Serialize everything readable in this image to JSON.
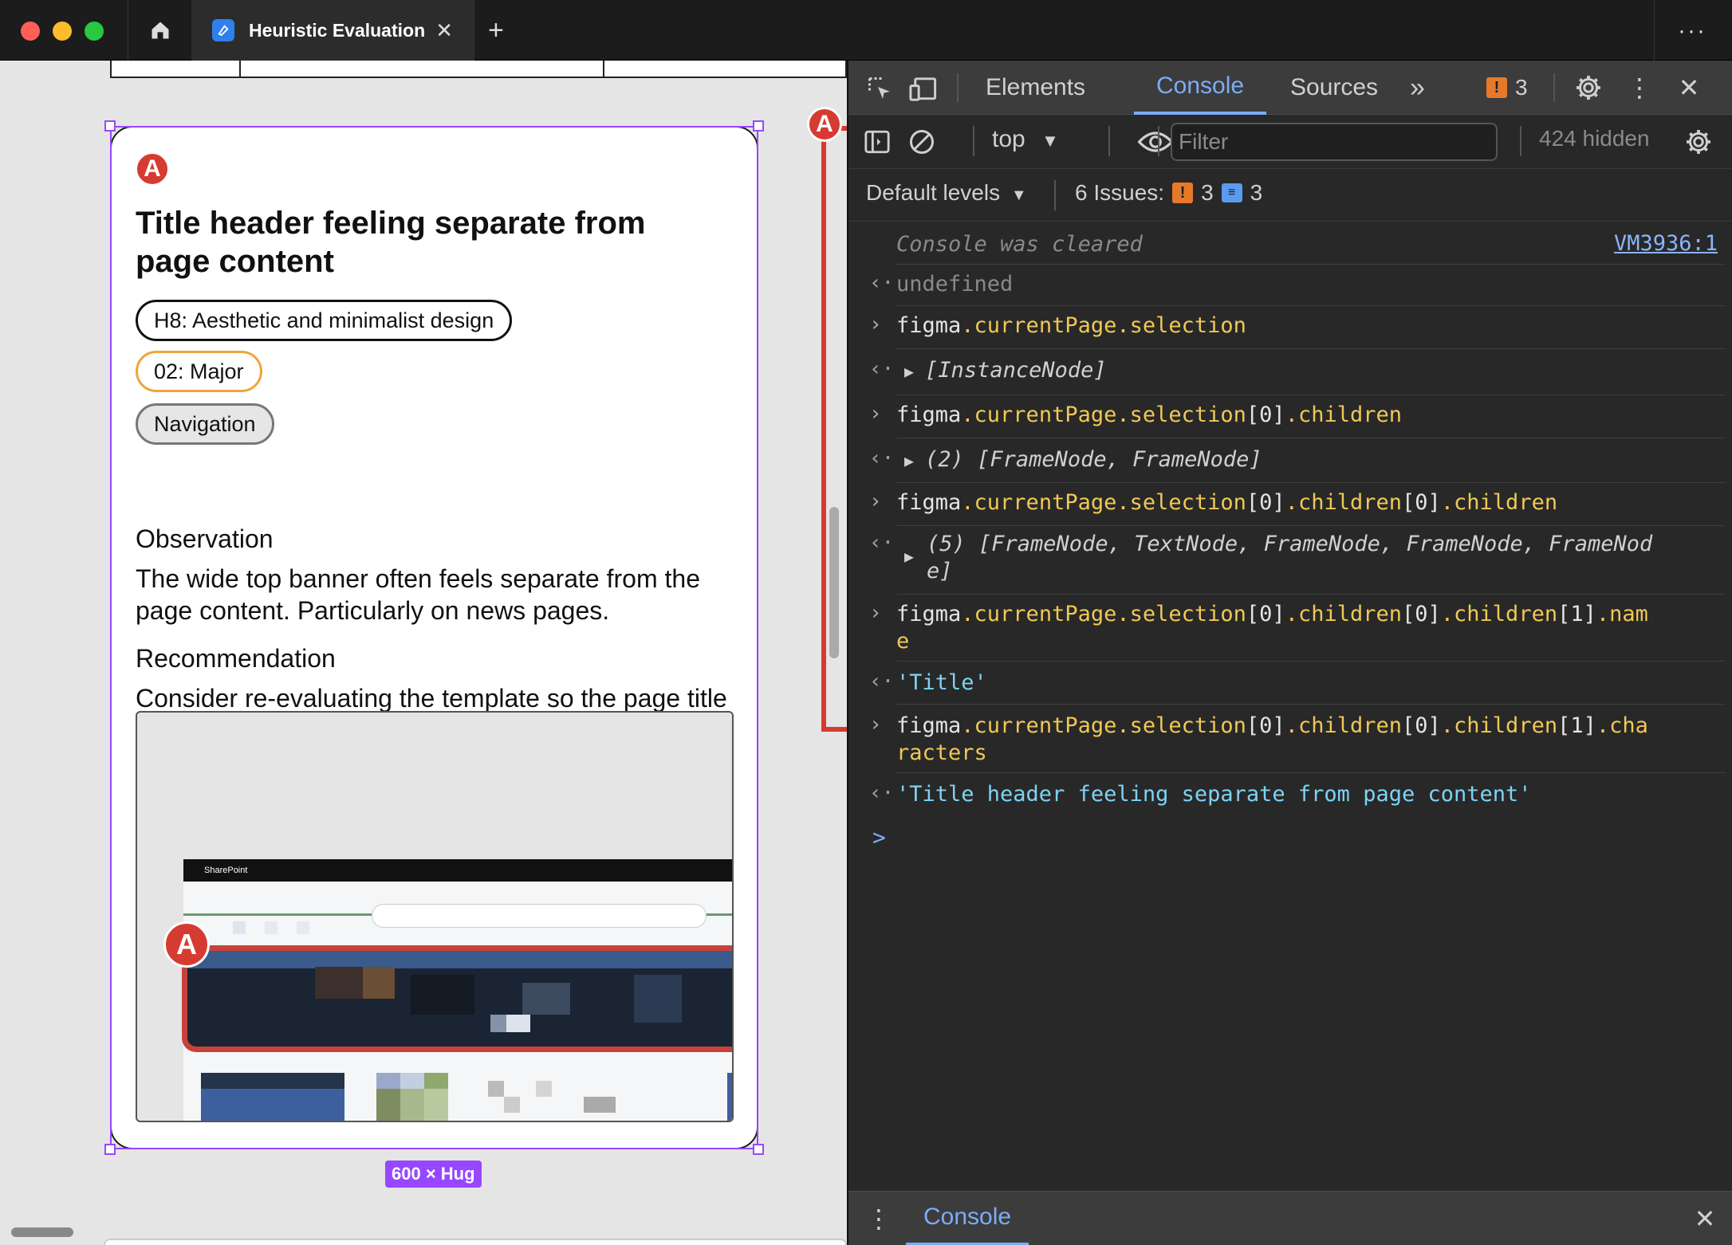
{
  "browser": {
    "tab_title": "Heuristic Evaluation",
    "close_tab_glyph": "✕",
    "new_tab_glyph": "+",
    "more_glyph": "···"
  },
  "canvas": {
    "card": {
      "badge": "A",
      "title": "Title header feeling separate from page content",
      "heuristic_tag": "H8: Aesthetic and minimalist design",
      "severity_tag": "02: Major",
      "category_tag": "Navigation",
      "observation_heading": "Observation",
      "observation_text": "The wide top banner often feels separate from the page content. Particularly on news pages.",
      "recommendation_heading": "Recommendation",
      "recommendation_text": "Consider re-evaluating the template so the page title sits within the body content.",
      "screenshot": {
        "app_name": "SharePoint",
        "badge": "A"
      }
    },
    "size_label": "600 × Hug",
    "marker_badge": "A"
  },
  "devtools": {
    "tabs": [
      {
        "label": "Elements"
      },
      {
        "label": "Console"
      },
      {
        "label": "Sources"
      }
    ],
    "more_tabs": "»",
    "issue_count": "3",
    "context": "top",
    "filter_placeholder": "Filter",
    "hidden_count": "424 hidden",
    "default_levels": "Default levels",
    "issues_label": "6 Issues:",
    "issues_warn": "3",
    "issues_info": "3",
    "console": {
      "cleared": "Console was cleared",
      "cleared_source": "VM3936:1",
      "undefined": "undefined",
      "cmd1_obj": "figma",
      "cmd1_props": ".currentPage.selection",
      "out1": "[InstanceNode]",
      "cmd2_a": "figma",
      "cmd2_b": ".currentPage.selection",
      "cmd2_c": "[0]",
      "cmd2_d": ".children",
      "out2": "(2) [FrameNode, FrameNode]",
      "cmd3_a": "figma",
      "cmd3_b": ".currentPage.selection",
      "cmd3_c": "[0]",
      "cmd3_d": ".children",
      "cmd3_e": "[0]",
      "cmd3_f": ".children",
      "out3_line1": "(5) [FrameNode, TextNode, FrameNode, FrameNode, FrameNod",
      "out3_line2": "e]",
      "cmd4_a": "figma",
      "cmd4_b": ".currentPage.selection",
      "cmd4_c": "[0]",
      "cmd4_d": ".children",
      "cmd4_e": "[0]",
      "cmd4_f": ".children",
      "cmd4_g": "[1]",
      "cmd4_h": ".nam",
      "cmd4_wrap": "e",
      "out4": "'Title'",
      "cmd5_a": "figma",
      "cmd5_b": ".currentPage.selection",
      "cmd5_c": "[0]",
      "cmd5_d": ".children",
      "cmd5_e": "[0]",
      "cmd5_f": ".children",
      "cmd5_g": "[1]",
      "cmd5_h": ".cha",
      "cmd5_wrap": "racters",
      "out5": "'Title header feeling separate from page content'",
      "prompt": ">"
    },
    "drawer_tab": "Console",
    "colors": {
      "accent": "#7cacf8",
      "warning": "#e7792b",
      "property": "#f0c855",
      "string": "#7cd3f5"
    }
  }
}
